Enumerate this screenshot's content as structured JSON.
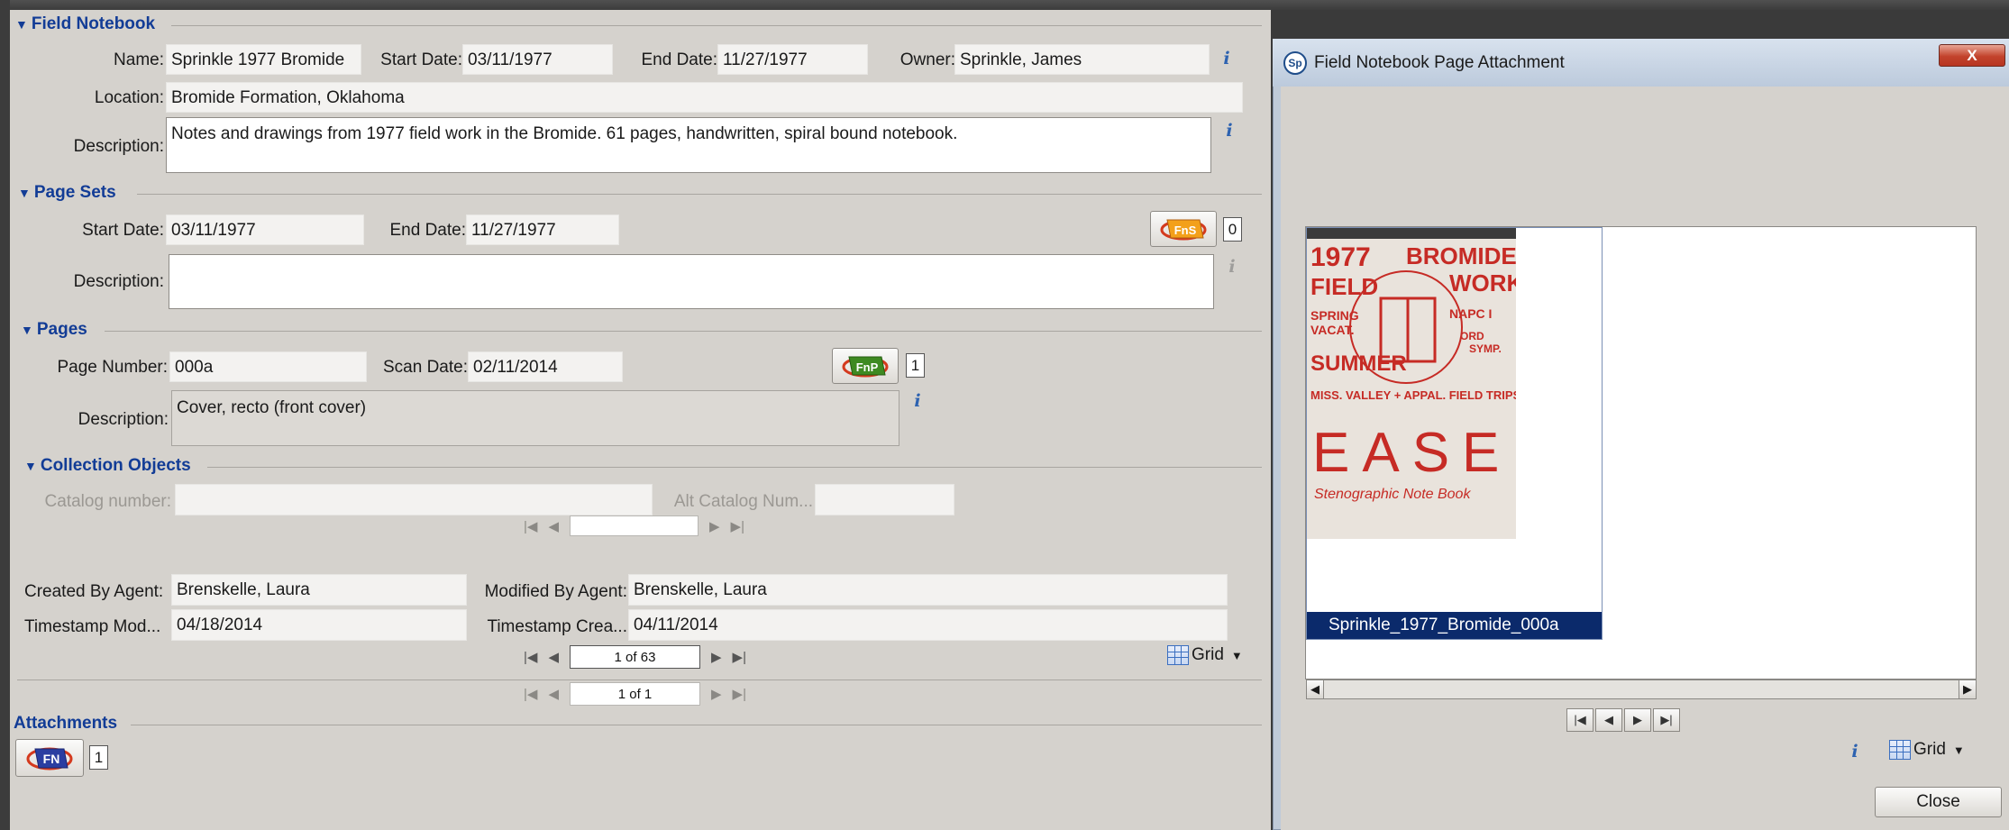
{
  "field_notebook": {
    "section_title": "Field Notebook",
    "name_label": "Name:",
    "name_value": "Sprinkle 1977 Bromide",
    "start_label": "Start Date:",
    "start_value": "03/11/1977",
    "end_label": "End Date:",
    "end_value": "11/27/1977",
    "owner_label": "Owner:",
    "owner_value": "Sprinkle, James",
    "location_label": "Location:",
    "location_value": "Bromide Formation, Oklahoma",
    "description_label": "Description:",
    "description_value": "Notes and drawings from 1977 field work in the Bromide. 61 pages, handwritten, spiral bound notebook."
  },
  "page_sets": {
    "section_title": "Page Sets",
    "start_label": "Start Date:",
    "start_value": "03/11/1977",
    "end_label": "End Date:",
    "end_value": "11/27/1977",
    "description_label": "Description:",
    "description_value": "",
    "button_text": "FnS",
    "count": "0"
  },
  "pages": {
    "section_title": "Pages",
    "page_number_label": "Page Number:",
    "page_number_value": "000a",
    "scan_date_label": "Scan Date:",
    "scan_date_value": "02/11/2014",
    "description_label": "Description:",
    "description_value": "Cover, recto (front cover)",
    "button_text": "FnP",
    "count": "1"
  },
  "collection_objects": {
    "section_title": "Collection Objects",
    "catalog_label": "Catalog number:",
    "alt_catalog_label": "Alt Catalog Num...",
    "pager_value": ""
  },
  "audit": {
    "created_by_label": "Created By Agent:",
    "created_by_value": "Brenskelle, Laura",
    "modified_by_label": "Modified By Agent:",
    "modified_by_value": "Brenskelle, Laura",
    "timestamp_mod_label": "Timestamp Mod...",
    "timestamp_mod_value": "04/18/2014",
    "timestamp_created_label": "Timestamp Crea...",
    "timestamp_created_value": "04/11/2014"
  },
  "pager_pages": "1 of 63",
  "pager_outer": "1 of 1",
  "grid_label": "Grid",
  "attachments": {
    "section_title": "Attachments",
    "button_text": "FN",
    "count": "1"
  },
  "dialog": {
    "title": "Field Notebook Page Attachment",
    "app_icon_text": "Sp",
    "close_x": "X",
    "thumbnail_caption": "Sprinkle_1977_Bromide_000a",
    "grid_label": "Grid",
    "close_button": "Close",
    "thumbnail_text": {
      "year": "1977",
      "line1": "BROMIDE",
      "field": "FIELD",
      "work": "WORK",
      "spring": "SPRING",
      "vacat": "VACAT.",
      "napc": "NAPC I",
      "ord": "ORD",
      "symp": "SYMP.",
      "summer": "SUMMER",
      "miss": "MISS. VALLEY + APPAL. FIELD TRIPS",
      "easel": "EASEL",
      "steno": "Stenographic Note Book"
    }
  },
  "colors": {
    "section_title": "#123c96",
    "panel_bg": "#d5d2cd",
    "selection": "#0b2a6b",
    "info_icon": "#2d62b0"
  }
}
